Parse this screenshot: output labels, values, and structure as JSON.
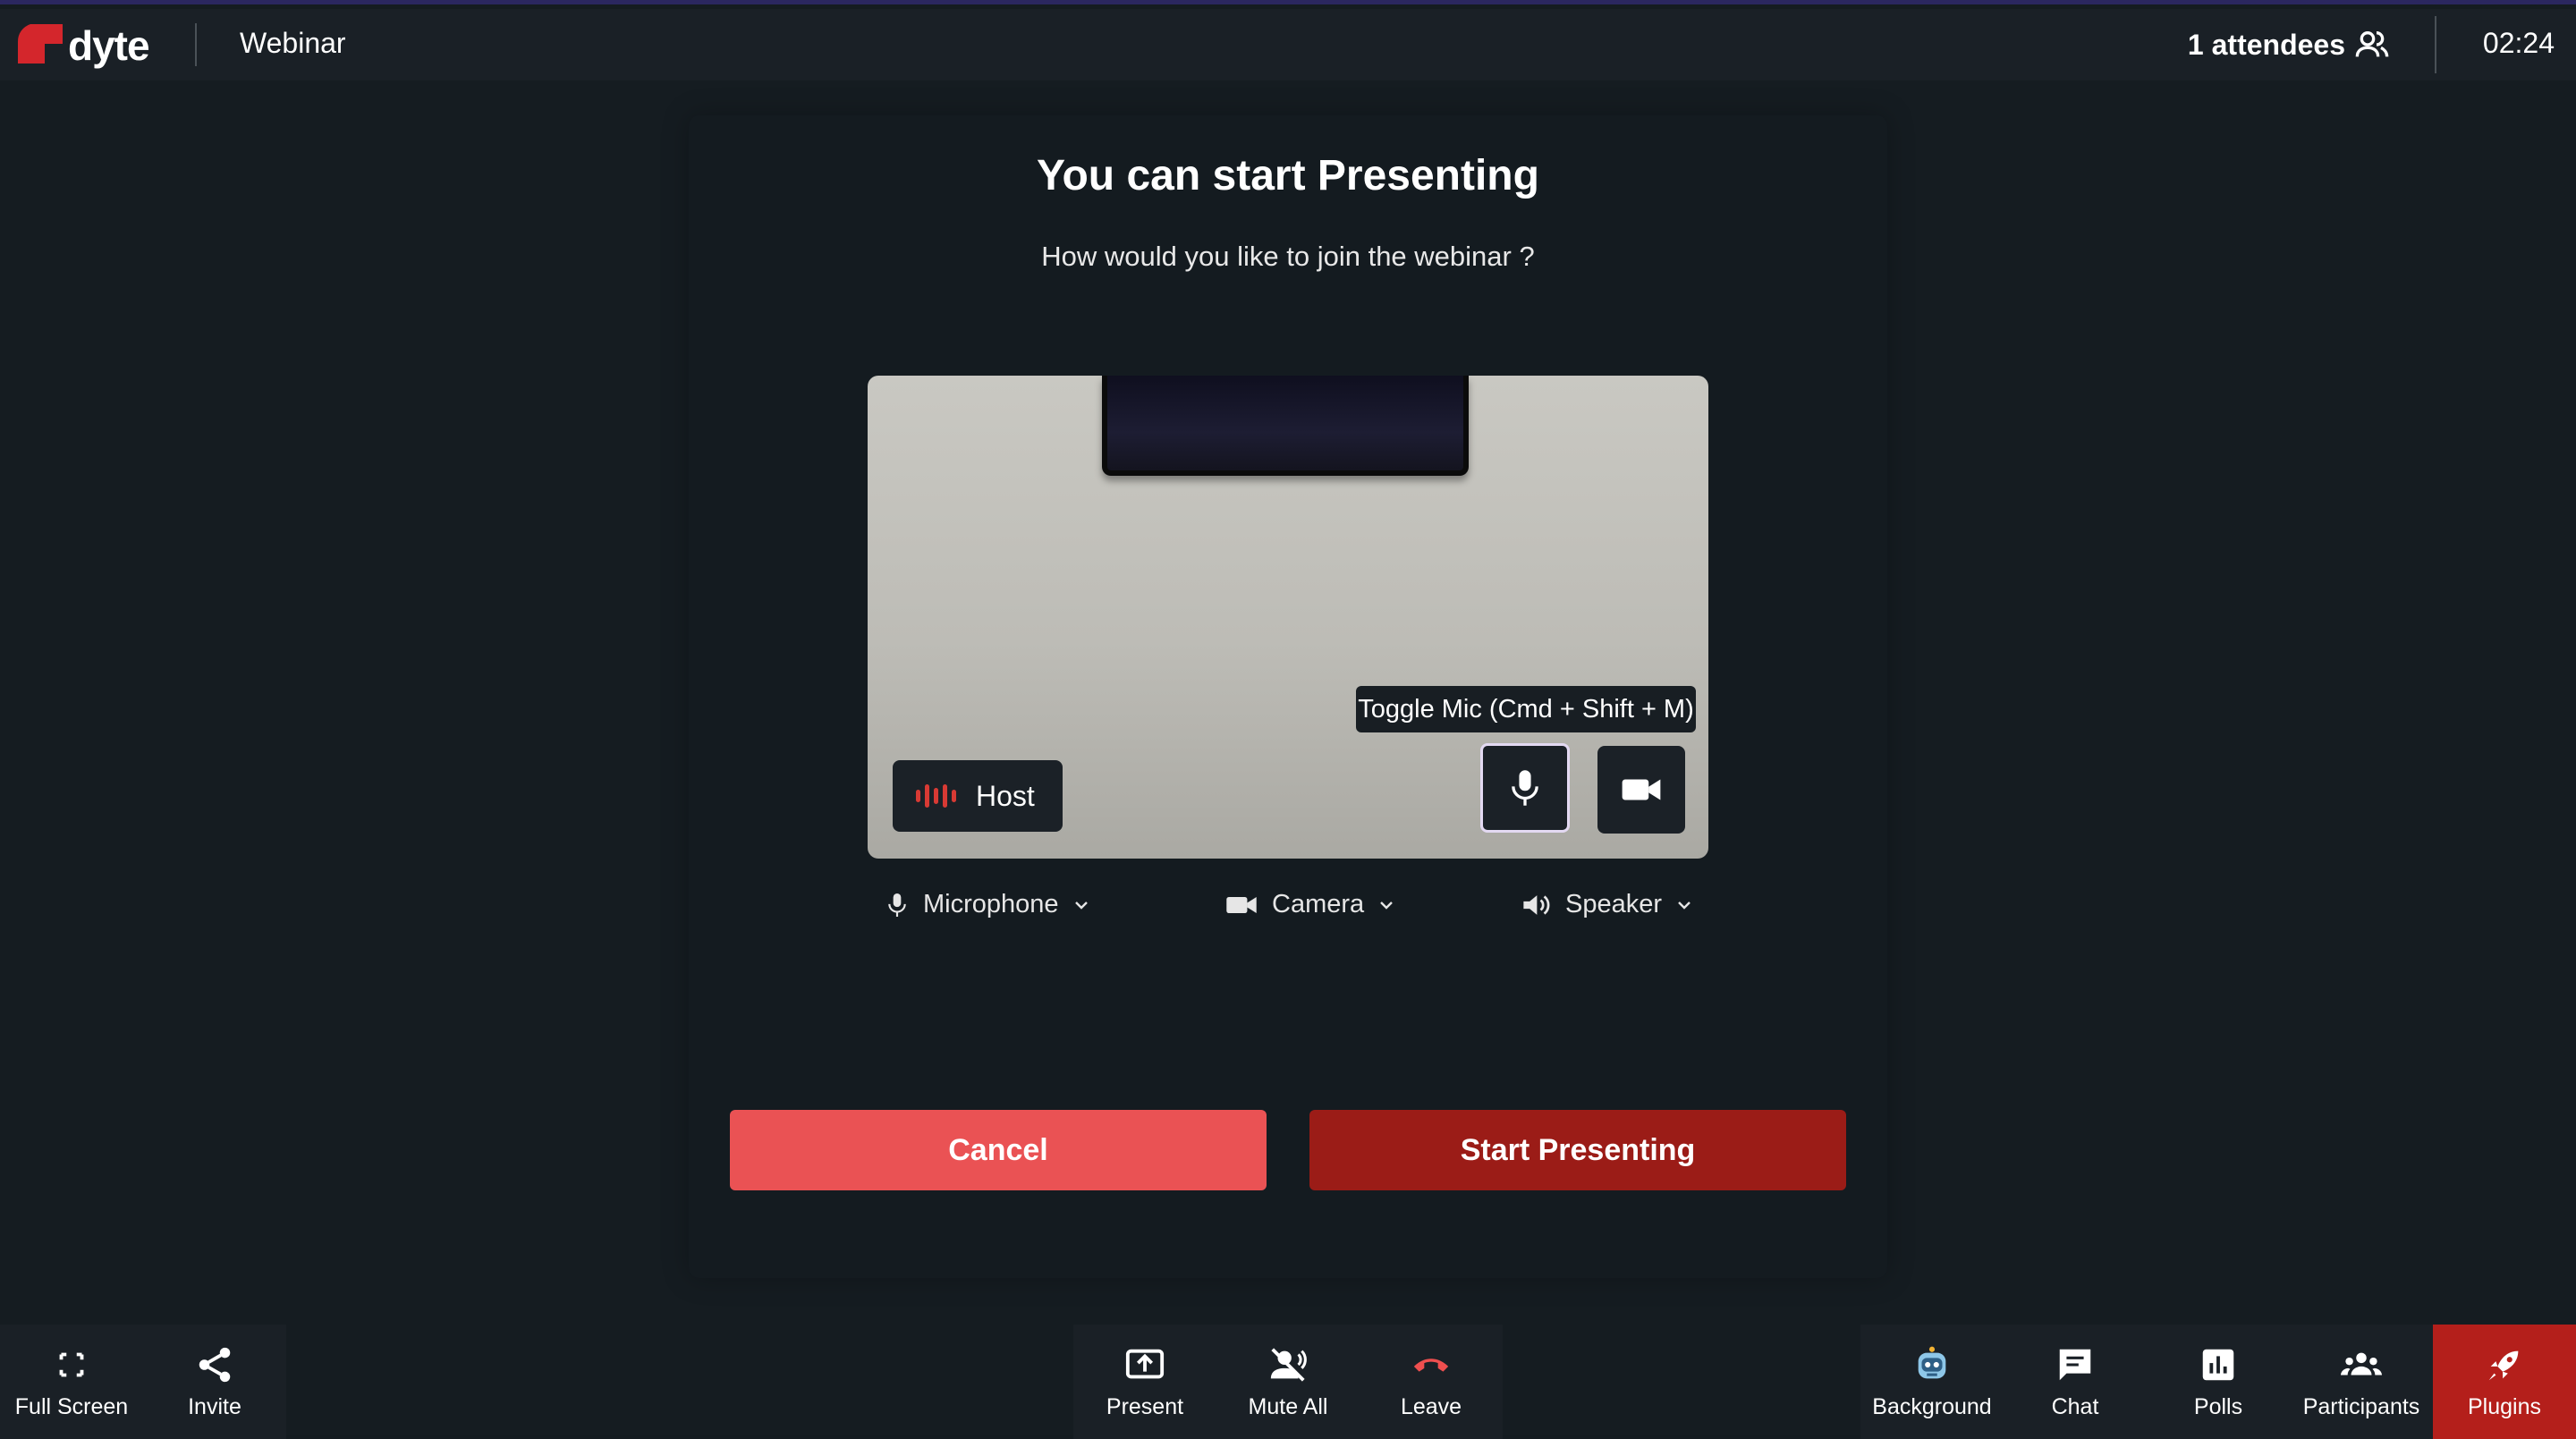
{
  "header": {
    "logo_text": "dyte",
    "meeting_title": "Webinar",
    "attendees_label": "1 attendees",
    "clock": "02:24"
  },
  "panel": {
    "title": "You can start Presenting",
    "subtitle": "How would you like to join the webinar ?",
    "host_label": "Host",
    "tooltip": "Toggle Mic (Cmd + Shift + M)"
  },
  "devices": {
    "microphone": "Microphone",
    "camera": "Camera",
    "speaker": "Speaker"
  },
  "actions": {
    "cancel": "Cancel",
    "start": "Start Presenting"
  },
  "toolbar": {
    "left": [
      {
        "label": "Full Screen",
        "icon": "fullscreen-icon"
      },
      {
        "label": "Invite",
        "icon": "share-icon"
      }
    ],
    "center": [
      {
        "label": "Present",
        "icon": "present-icon"
      },
      {
        "label": "Mute All",
        "icon": "mute-all-icon"
      },
      {
        "label": "Leave",
        "icon": "leave-call-icon"
      }
    ],
    "right": [
      {
        "label": "Background",
        "icon": "background-robot-icon"
      },
      {
        "label": "Chat",
        "icon": "chat-icon"
      },
      {
        "label": "Polls",
        "icon": "polls-icon"
      },
      {
        "label": "Participants",
        "icon": "participants-icon"
      },
      {
        "label": "Plugins",
        "icon": "rocket-icon"
      }
    ]
  },
  "colors": {
    "brand_red": "#b41f1b",
    "cancel_red": "#ea5254",
    "start_red": "#9b1c17",
    "background": "#151c21",
    "bar": "#1a2026"
  }
}
